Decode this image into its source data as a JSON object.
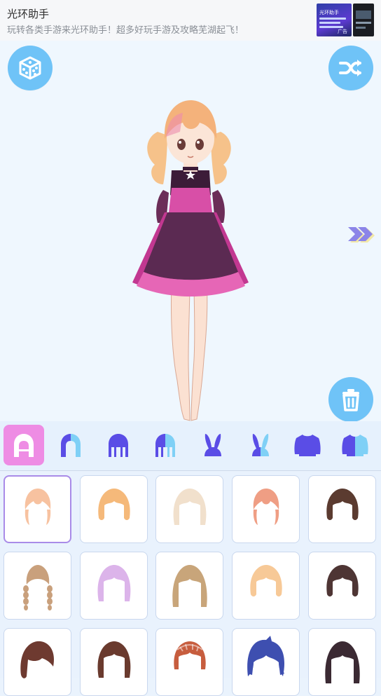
{
  "ad": {
    "title": "光环助手",
    "description": "玩转各类手游来光环助手！超多好玩手游及攻略芜湖起飞！",
    "thumb_text": "光环助手",
    "thumb_tag": "广告"
  },
  "toolbar": {
    "random_icon": "dice-icon",
    "shuffle_icon": "shuffle-icon",
    "next_icon": "double-chevron-right-icon",
    "delete_icon": "trash-icon"
  },
  "colors": {
    "accent": "#6fc3f7",
    "tab_selected": "#ee8ce4",
    "tab_icon": "#5a4de6",
    "cell_selected_border": "#a98be8"
  },
  "tabs": [
    {
      "name": "hair-front",
      "icon": "hair-front-icon",
      "selected": true
    },
    {
      "name": "hair-back",
      "icon": "hair-half-icon",
      "selected": false
    },
    {
      "name": "hair-long",
      "icon": "hair-long-icon",
      "selected": false
    },
    {
      "name": "hair-long-half",
      "icon": "hair-long-half-icon",
      "selected": false
    },
    {
      "name": "bunny-ears",
      "icon": "bunny-ears-icon",
      "selected": false
    },
    {
      "name": "bunny-ears-half",
      "icon": "bunny-ears-half-icon",
      "selected": false
    },
    {
      "name": "top",
      "icon": "sweater-icon",
      "selected": false
    },
    {
      "name": "top-half",
      "icon": "sweater-half-icon",
      "selected": false
    }
  ],
  "hair_items": [
    {
      "color": "#f7c2a0",
      "style": "bangs-short",
      "selected": true
    },
    {
      "color": "#f5b97a",
      "style": "bob",
      "selected": false
    },
    {
      "color": "#f1e0cc",
      "style": "bob-long",
      "selected": false
    },
    {
      "color": "#ef9e84",
      "style": "bangs-short",
      "selected": false
    },
    {
      "color": "#5b3b30",
      "style": "bob",
      "selected": false
    },
    {
      "color": "#c9a07c",
      "style": "braids",
      "selected": false
    },
    {
      "color": "#dcb4ea",
      "style": "bob-long",
      "selected": false
    },
    {
      "color": "#c8a57a",
      "style": "long",
      "selected": false
    },
    {
      "color": "#f7c997",
      "style": "bob",
      "selected": false
    },
    {
      "color": "#4e3534",
      "style": "bob",
      "selected": false
    },
    {
      "color": "#6e3a30",
      "style": "side",
      "selected": false
    },
    {
      "color": "#6a3a2e",
      "style": "bob-long",
      "selected": false
    },
    {
      "color": "#c75d3e",
      "style": "braid-crown",
      "selected": false
    },
    {
      "color": "#3e4fb0",
      "style": "messy",
      "selected": false
    },
    {
      "color": "#3b2a33",
      "style": "long",
      "selected": false
    }
  ]
}
